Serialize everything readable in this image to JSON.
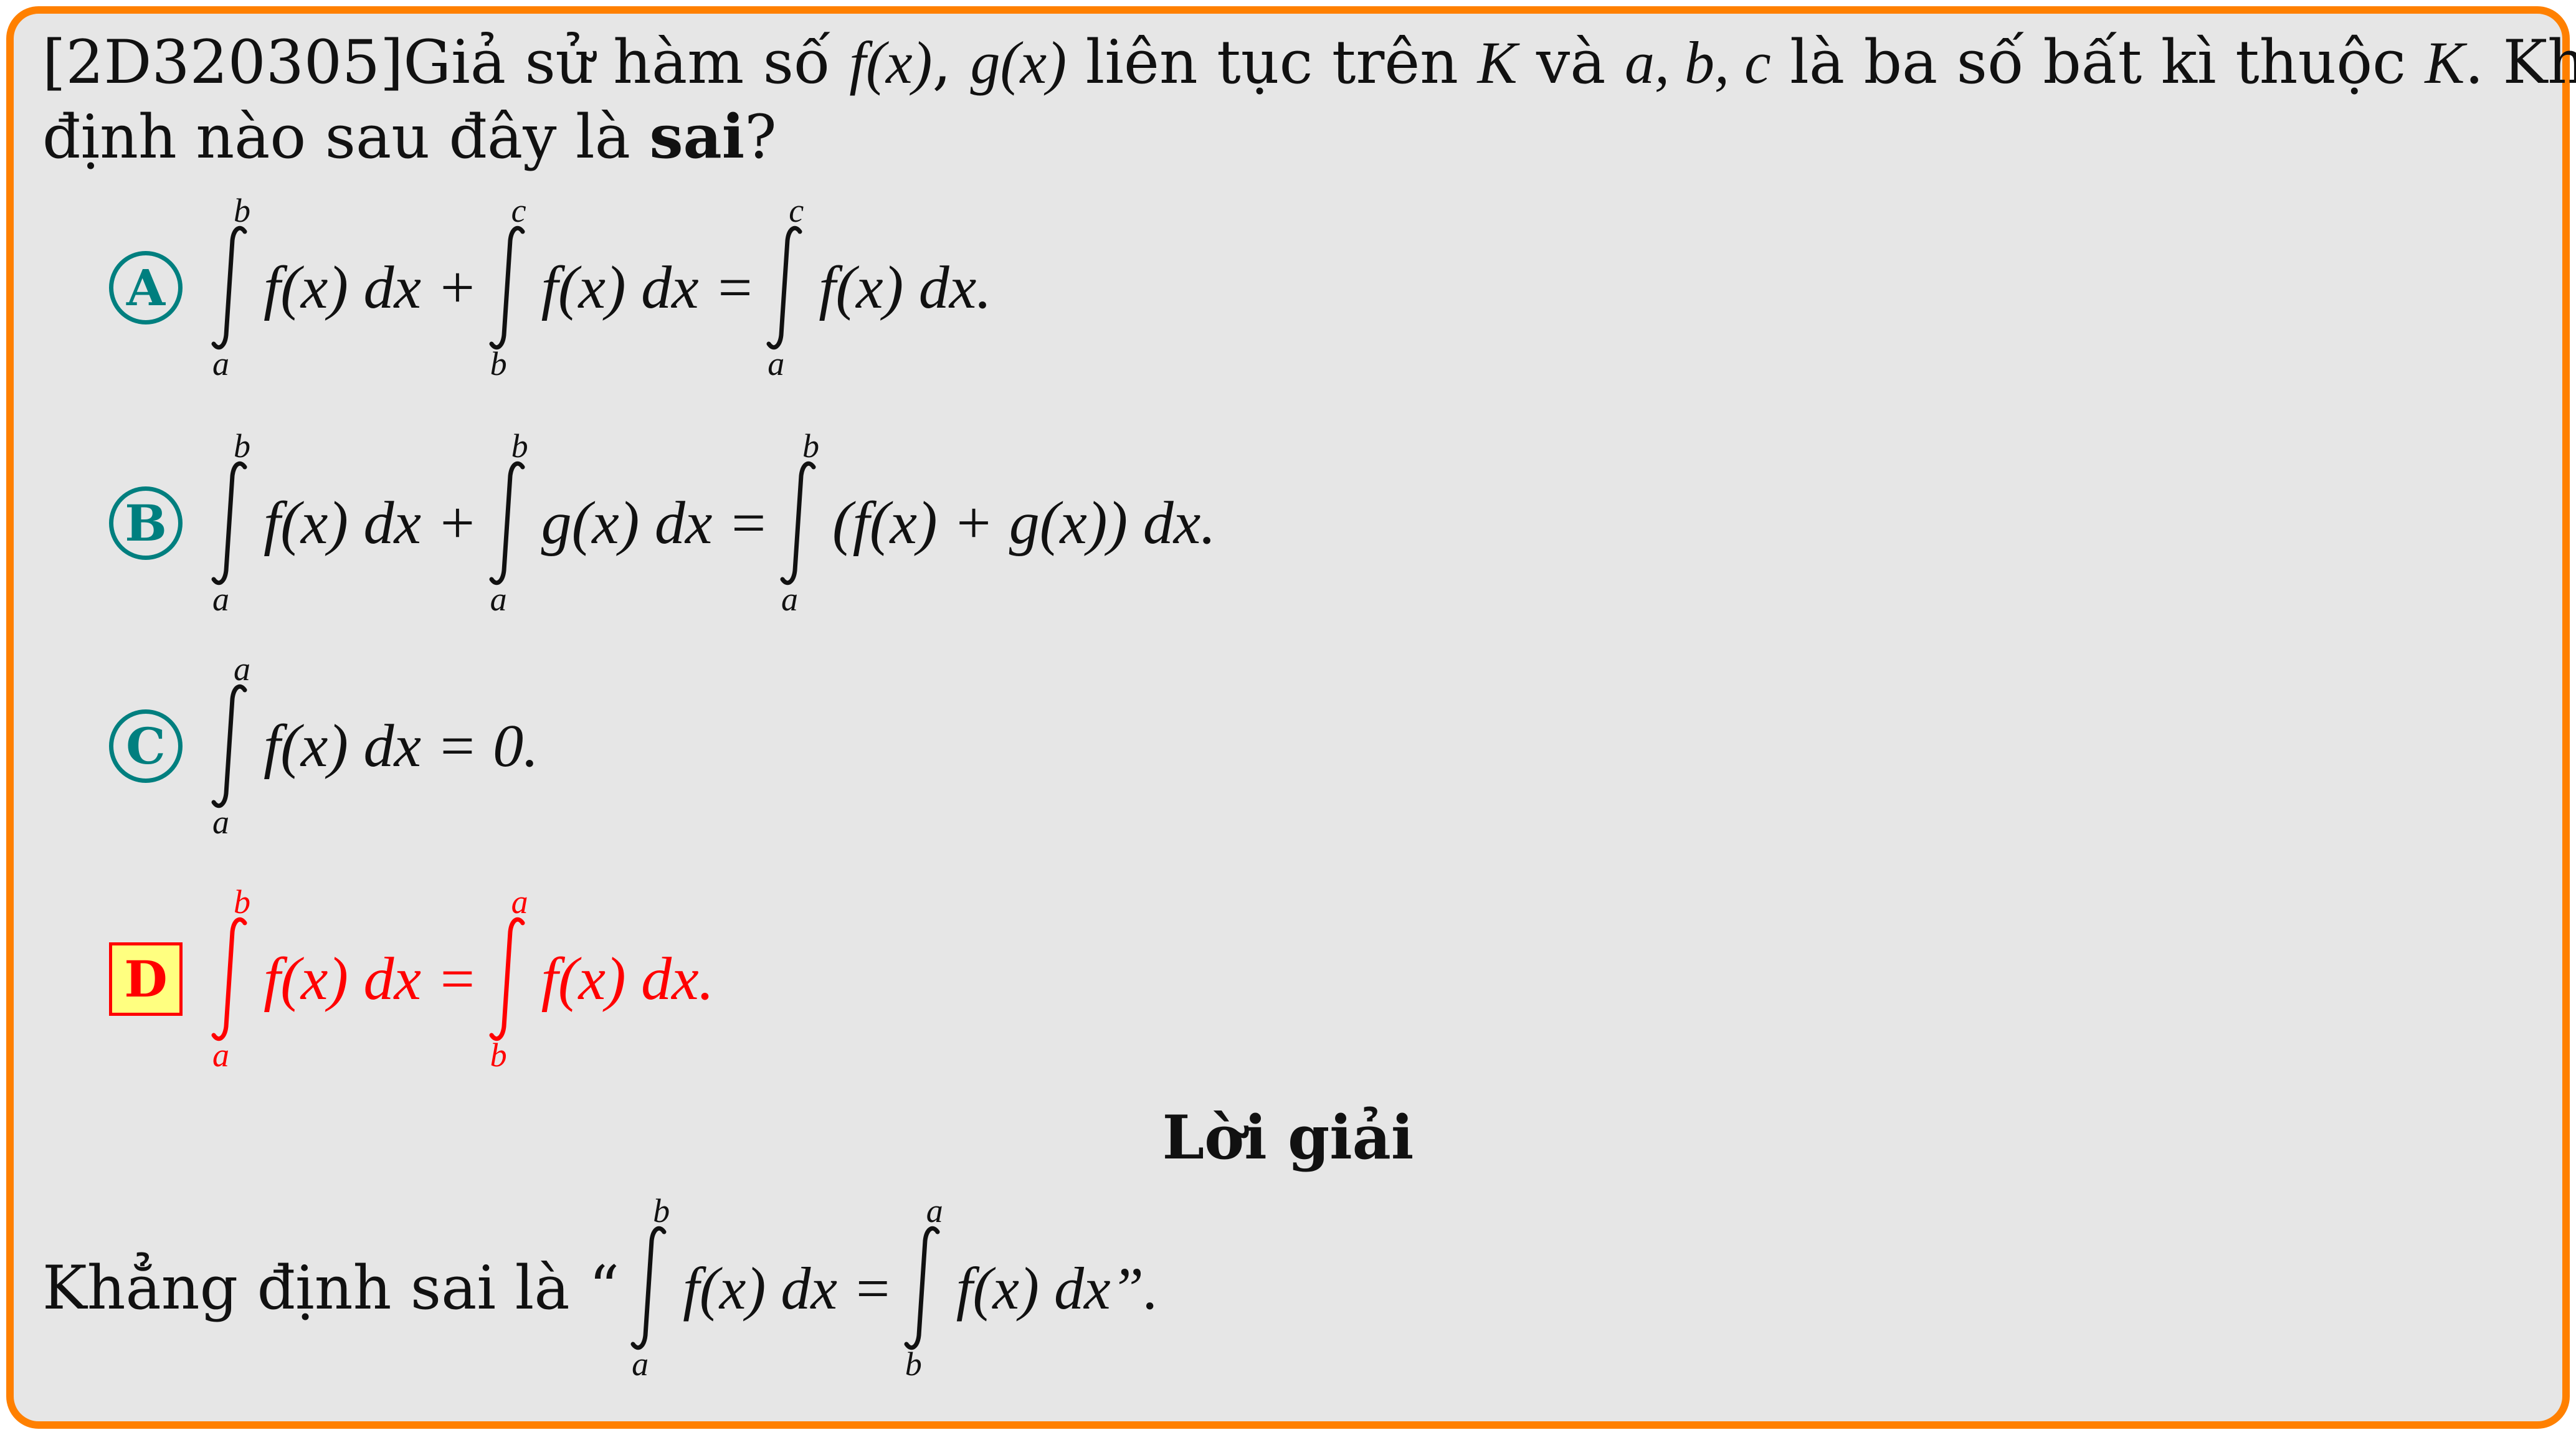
{
  "question": {
    "code": "[2D320305]",
    "line1_a": "Giả sử hàm số ",
    "f_x": "f(x)",
    "comma": ", ",
    "g_x": "g(x)",
    "line1_b": " liên tục trên ",
    "K": "K",
    "line1_c": " và ",
    "abc": "a, b, c",
    "line1_d": " là ba số bất kì thuộc ",
    "K2": "K",
    "line1_e": ". Khẳng",
    "line2_a": "định nào sau đây là ",
    "sai": "sai",
    "line2_b": "?"
  },
  "options": [
    {
      "label": "A",
      "i1_up": "b",
      "i1_lo": "a",
      "t1": "f(x) dx +",
      "i2_up": "c",
      "i2_lo": "b",
      "t2": "f(x) dx =",
      "i3_up": "c",
      "i3_lo": "a",
      "t3": "f(x) dx."
    },
    {
      "label": "B",
      "i1_up": "b",
      "i1_lo": "a",
      "t1": "f(x) dx +",
      "i2_up": "b",
      "i2_lo": "a",
      "t2": "g(x) dx =",
      "i3_up": "b",
      "i3_lo": "a",
      "t3": "(f(x) + g(x)) dx."
    },
    {
      "label": "C",
      "i1_up": "a",
      "i1_lo": "a",
      "t1": "f(x) dx = 0."
    },
    {
      "label": "D",
      "i1_up": "b",
      "i1_lo": "a",
      "t1": "f(x) dx =",
      "i2_up": "a",
      "i2_lo": "b",
      "t2": "f(x) dx."
    }
  ],
  "solution": {
    "title": "Lời giải",
    "text_a": "Khẳng định sai là “",
    "i1_up": "b",
    "i1_lo": "a",
    "t1": "f(x) dx =",
    "i2_up": "a",
    "i2_lo": "b",
    "t2": "f(x) dx”."
  },
  "colors": {
    "border": "#ff8000",
    "background": "#e6e6e6",
    "option_label": "#007f7f",
    "correct_answer": "#ff0000",
    "correct_label_fill": "#ffff80"
  }
}
